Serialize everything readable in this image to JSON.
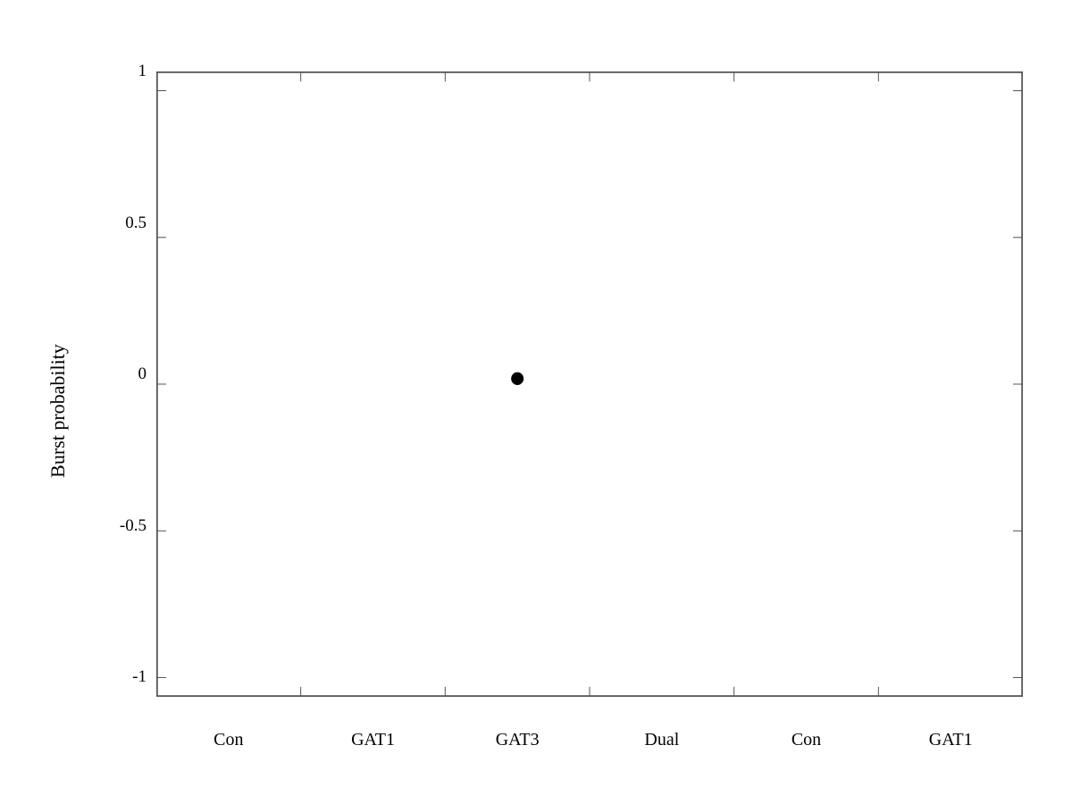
{
  "chart": {
    "title": "",
    "y_axis_label": "Burst probability",
    "x_labels": [
      "Con",
      "GAT1",
      "GAT3",
      "Dual",
      "Con",
      "GAT1"
    ],
    "y_ticks": [
      "1",
      "0.5",
      "0",
      "-0.5",
      "-1"
    ],
    "y_min": -1,
    "y_max": 1,
    "data_points": [
      {
        "x_index": 2,
        "y": 0.02
      }
    ],
    "colors": {
      "axes": "#555555",
      "point": "#000000",
      "tick_line": "#aaaaaa"
    }
  }
}
